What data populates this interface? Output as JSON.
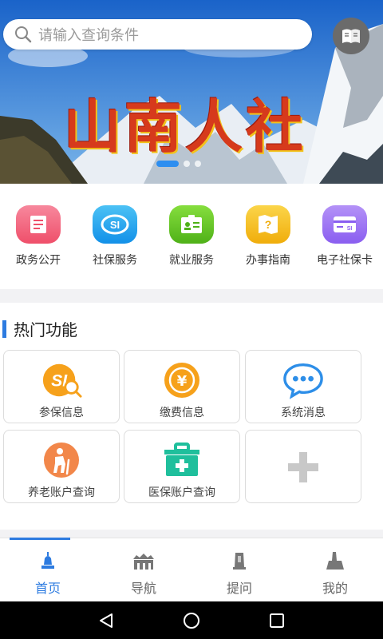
{
  "search": {
    "placeholder": "请输入查询条件"
  },
  "banner": {
    "logo_text": "山南人社",
    "slides": 3,
    "active_slide": 0
  },
  "quick_services": [
    {
      "label": "政务公开",
      "icon": "document-icon",
      "color": "#f0607a"
    },
    {
      "label": "社保服务",
      "icon": "si-card-icon",
      "color": "#1fa4ee"
    },
    {
      "label": "就业服务",
      "icon": "id-card-icon",
      "color": "#6dcb2b"
    },
    {
      "label": "办事指南",
      "icon": "question-map-icon",
      "color": "#f5c117"
    },
    {
      "label": "电子社保卡",
      "icon": "e-card-icon",
      "color": "#9f76f0"
    }
  ],
  "hot": {
    "title": "热门功能",
    "items": [
      {
        "label": "参保信息",
        "icon": "insurance-search-icon"
      },
      {
        "label": "缴费信息",
        "icon": "yuan-coin-icon"
      },
      {
        "label": "系统消息",
        "icon": "chat-bubble-icon"
      },
      {
        "label": "养老账户查询",
        "icon": "elderly-icon"
      },
      {
        "label": "医保账户查询",
        "icon": "medical-kit-icon"
      },
      {
        "label": "",
        "icon": "add-icon"
      }
    ]
  },
  "tabs": [
    {
      "label": "首页",
      "active": true
    },
    {
      "label": "导航",
      "active": false
    },
    {
      "label": "提问",
      "active": false
    },
    {
      "label": "我的",
      "active": false
    }
  ],
  "colors": {
    "accent": "#2d7be0",
    "background": "#f2f2f4"
  }
}
